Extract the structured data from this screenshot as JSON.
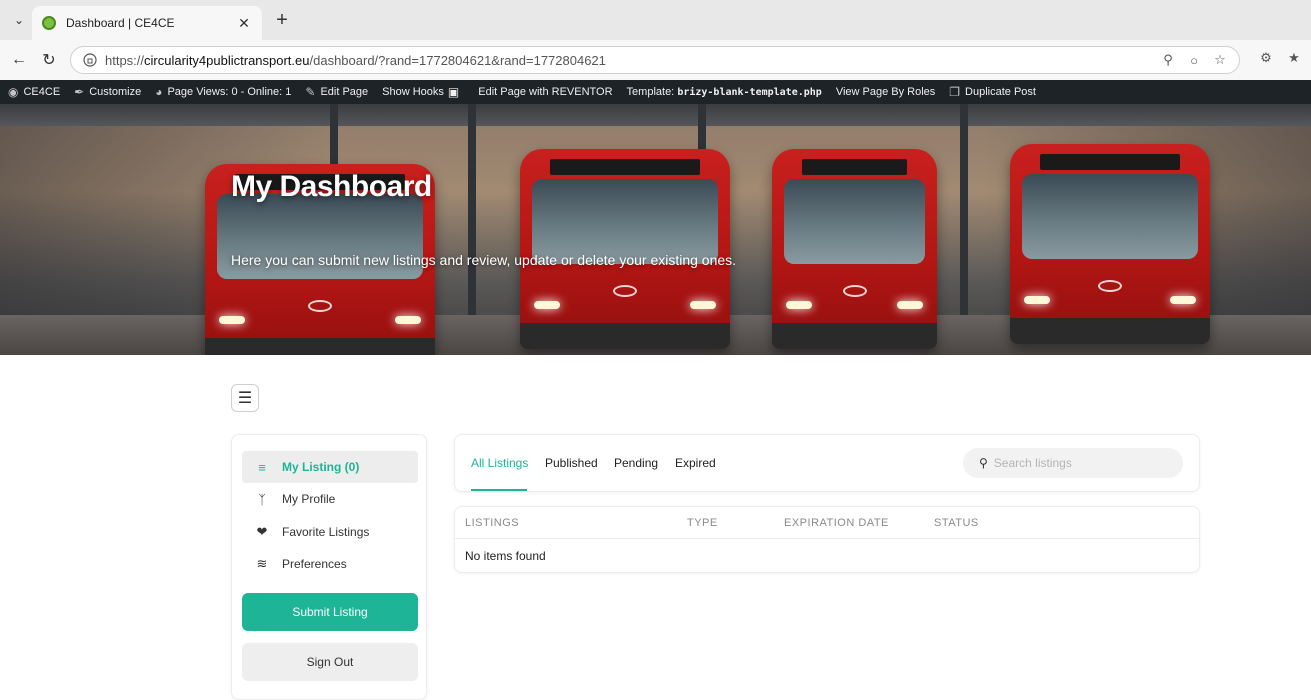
{
  "browser": {
    "tab_title": "Dashboard | CE4CE",
    "url_prefix": "https://",
    "url_host": "circularity4publictransport.eu",
    "url_path": "/dashboard/?rand=1772804621&rand=1772804621"
  },
  "adminbar": {
    "items": [
      {
        "label": "CE4CE"
      },
      {
        "label": "Customize"
      },
      {
        "label": "Page Views: 0 - Online: 1"
      },
      {
        "label": "Edit Page"
      },
      {
        "label": "Show Hooks"
      },
      {
        "label": "Edit Page with REVENTOR"
      },
      {
        "label": "Template:"
      },
      {
        "label": "View Page By Roles"
      },
      {
        "label": "Duplicate Post"
      }
    ],
    "template_file": "brizy-blank-template.php"
  },
  "hero": {
    "title": "My Dashboard",
    "subtitle": "Here you can submit new listings and review, update or delete your existing ones."
  },
  "sidebar": {
    "items": [
      {
        "label": "My Listing (0)",
        "icon": "list-icon"
      },
      {
        "label": "My Profile",
        "icon": "user-icon"
      },
      {
        "label": "Favorite Listings",
        "icon": "heart-icon"
      },
      {
        "label": "Preferences",
        "icon": "sliders-icon"
      }
    ],
    "submit_label": "Submit Listing",
    "signout_label": "Sign Out"
  },
  "filters": {
    "tabs": [
      {
        "label": "All Listings"
      },
      {
        "label": "Published"
      },
      {
        "label": "Pending"
      },
      {
        "label": "Expired"
      }
    ],
    "search_placeholder": "Search listings"
  },
  "table": {
    "columns": [
      "LISTINGS",
      "TYPE",
      "EXPIRATION DATE",
      "STATUS"
    ],
    "empty_text": "No items found"
  },
  "colors": {
    "accent": "#1eb596",
    "adminbar": "#1d2327"
  }
}
